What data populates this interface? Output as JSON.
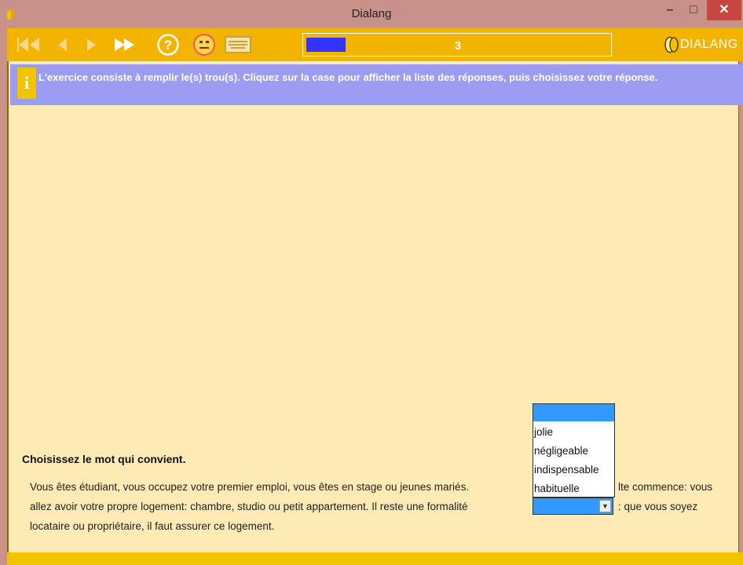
{
  "window": {
    "title": "Dialang",
    "minimize": "–",
    "maximize": "□",
    "close": "✕"
  },
  "toolbar": {
    "progress_label": "3",
    "progress_fraction": 0.13,
    "logo_text": "DIALANG",
    "icons": [
      "first-icon",
      "back-icon",
      "forward-icon",
      "fast-forward-icon",
      "help-icon",
      "smiley-icon",
      "keyboard-icon"
    ]
  },
  "info": {
    "icon_glyph": "i",
    "text": "L'exercice consiste à remplir le(s) trou(s). Cliquez sur la case pour afficher la liste des réponses, puis choisissez votre réponse."
  },
  "question": {
    "title": "Choisissez le mot qui convient.",
    "line1_before": "Vous êtes étudiant, vous occupez votre premier emploi, vous êtes en stage ou jeunes mariés.",
    "line1_after": "lte commence: vous",
    "line2_before": "allez avoir votre propre logement: chambre, studio ou petit appartement. Il reste une formalité",
    "line2_after": ": que vous soyez",
    "line3": "locataire ou propriétaire, il faut assurer ce logement."
  },
  "dropdown": {
    "selected_value": "",
    "options": [
      "jolie",
      "négligeable",
      "indispensable",
      "habituelle"
    ],
    "arrow": "▼"
  },
  "colors": {
    "titlebar": "#c8928a",
    "toolbar": "#f2b400",
    "content_bg": "#fdeab5",
    "info_bg": "#9b9cf2",
    "progress_fill": "#3333ff",
    "selection": "#3399ff"
  }
}
